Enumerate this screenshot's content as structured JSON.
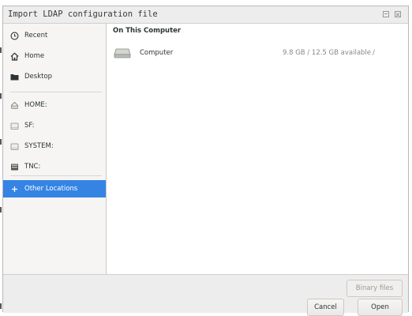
{
  "window": {
    "title": "Import LDAP configuration file"
  },
  "sidebar": {
    "items": [
      {
        "label": "Recent",
        "icon": "clock-icon"
      },
      {
        "label": "Home",
        "icon": "home-icon"
      },
      {
        "label": "Desktop",
        "icon": "folder-icon"
      },
      {
        "label": "HOME:",
        "icon": "network-drive-icon"
      },
      {
        "label": "SF:",
        "icon": "drive-icon"
      },
      {
        "label": "SYSTEM:",
        "icon": "drive-icon"
      },
      {
        "label": "TNC:",
        "icon": "drive-icon"
      },
      {
        "label": "Other Locations",
        "icon": "plus-icon",
        "selected": true
      }
    ]
  },
  "main": {
    "section_header": "On This Computer",
    "locations": [
      {
        "name": "Computer",
        "space": "9.8 GB / 12.5 GB available",
        "path": "/",
        "icon": "hard-drive-icon"
      }
    ]
  },
  "footer": {
    "filter_label": "Binary files",
    "cancel_label": "Cancel",
    "open_label": "Open"
  },
  "colors": {
    "accent": "#3584e4",
    "sidebar_bg": "#f6f5f4",
    "titlebar_bg": "#ededed"
  }
}
